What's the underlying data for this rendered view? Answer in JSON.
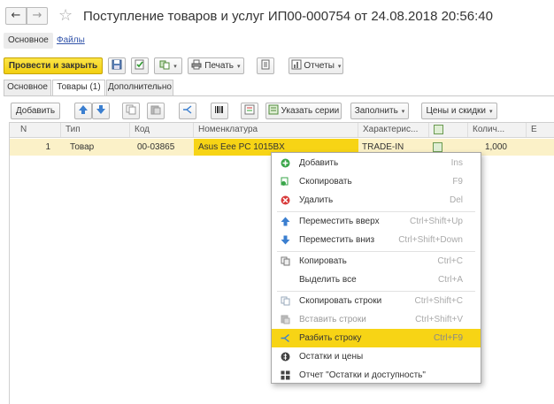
{
  "window": {
    "title": "Поступление товаров и услуг ИП00-000754 от 24.08.2018 20:56:40"
  },
  "sections": {
    "main": "Основное",
    "files": "Файлы"
  },
  "command_bar": {
    "post_close": "Провести и закрыть",
    "print": "Печать",
    "reports": "Отчеты"
  },
  "tabs": [
    {
      "label": "Основное",
      "active": false
    },
    {
      "label": "Товары (1)",
      "active": true
    },
    {
      "label": "Дополнительно",
      "active": false
    }
  ],
  "table_toolbar": {
    "add": "Добавить",
    "series": "Указать серии",
    "fill": "Заполнить",
    "prices": "Цены и скидки"
  },
  "grid": {
    "columns": [
      "N",
      "Тип",
      "Код",
      "Номенклатура",
      "Характерис...",
      "",
      "Колич...",
      "Е"
    ],
    "rows": [
      {
        "n": "1",
        "type": "Товар",
        "code": "00-03865",
        "item": "Asus Eee PC 1015BX",
        "characteristic": "TRADE-IN",
        "qty": "1,000"
      }
    ]
  },
  "context_menu": {
    "items": [
      {
        "label": "Добавить",
        "shortcut": "Ins",
        "icon": "add-icon",
        "enabled": true
      },
      {
        "label": "Скопировать",
        "shortcut": "F9",
        "icon": "copy-row-icon",
        "enabled": true
      },
      {
        "label": "Удалить",
        "shortcut": "Del",
        "icon": "delete-icon",
        "enabled": true
      },
      {
        "label": "Переместить вверх",
        "shortcut": "Ctrl+Shift+Up",
        "icon": "arrow-up-icon",
        "enabled": true
      },
      {
        "label": "Переместить вниз",
        "shortcut": "Ctrl+Shift+Down",
        "icon": "arrow-down-icon",
        "enabled": true
      },
      {
        "label": "Копировать",
        "shortcut": "Ctrl+C",
        "icon": "clipboard-copy-icon",
        "enabled": true
      },
      {
        "label": "Выделить все",
        "shortcut": "Ctrl+A",
        "icon": "",
        "enabled": true
      },
      {
        "label": "Скопировать строки",
        "shortcut": "Ctrl+Shift+C",
        "icon": "copy-lines-icon",
        "enabled": true
      },
      {
        "label": "Вставить строки",
        "shortcut": "Ctrl+Shift+V",
        "icon": "paste-lines-icon",
        "enabled": false
      },
      {
        "label": "Разбить строку",
        "shortcut": "Ctrl+F9",
        "icon": "split-row-icon",
        "enabled": true,
        "highlighted": true
      },
      {
        "label": "Остатки и цены",
        "shortcut": "",
        "icon": "stock-prices-icon",
        "enabled": true
      },
      {
        "label": "Отчет \"Остатки и доступность\"",
        "shortcut": "",
        "icon": "report-icon",
        "enabled": true
      }
    ]
  },
  "colors": {
    "accent_yellow": "#f7d415",
    "row_highlight": "#fbf1c8",
    "link_blue": "#3355aa"
  }
}
